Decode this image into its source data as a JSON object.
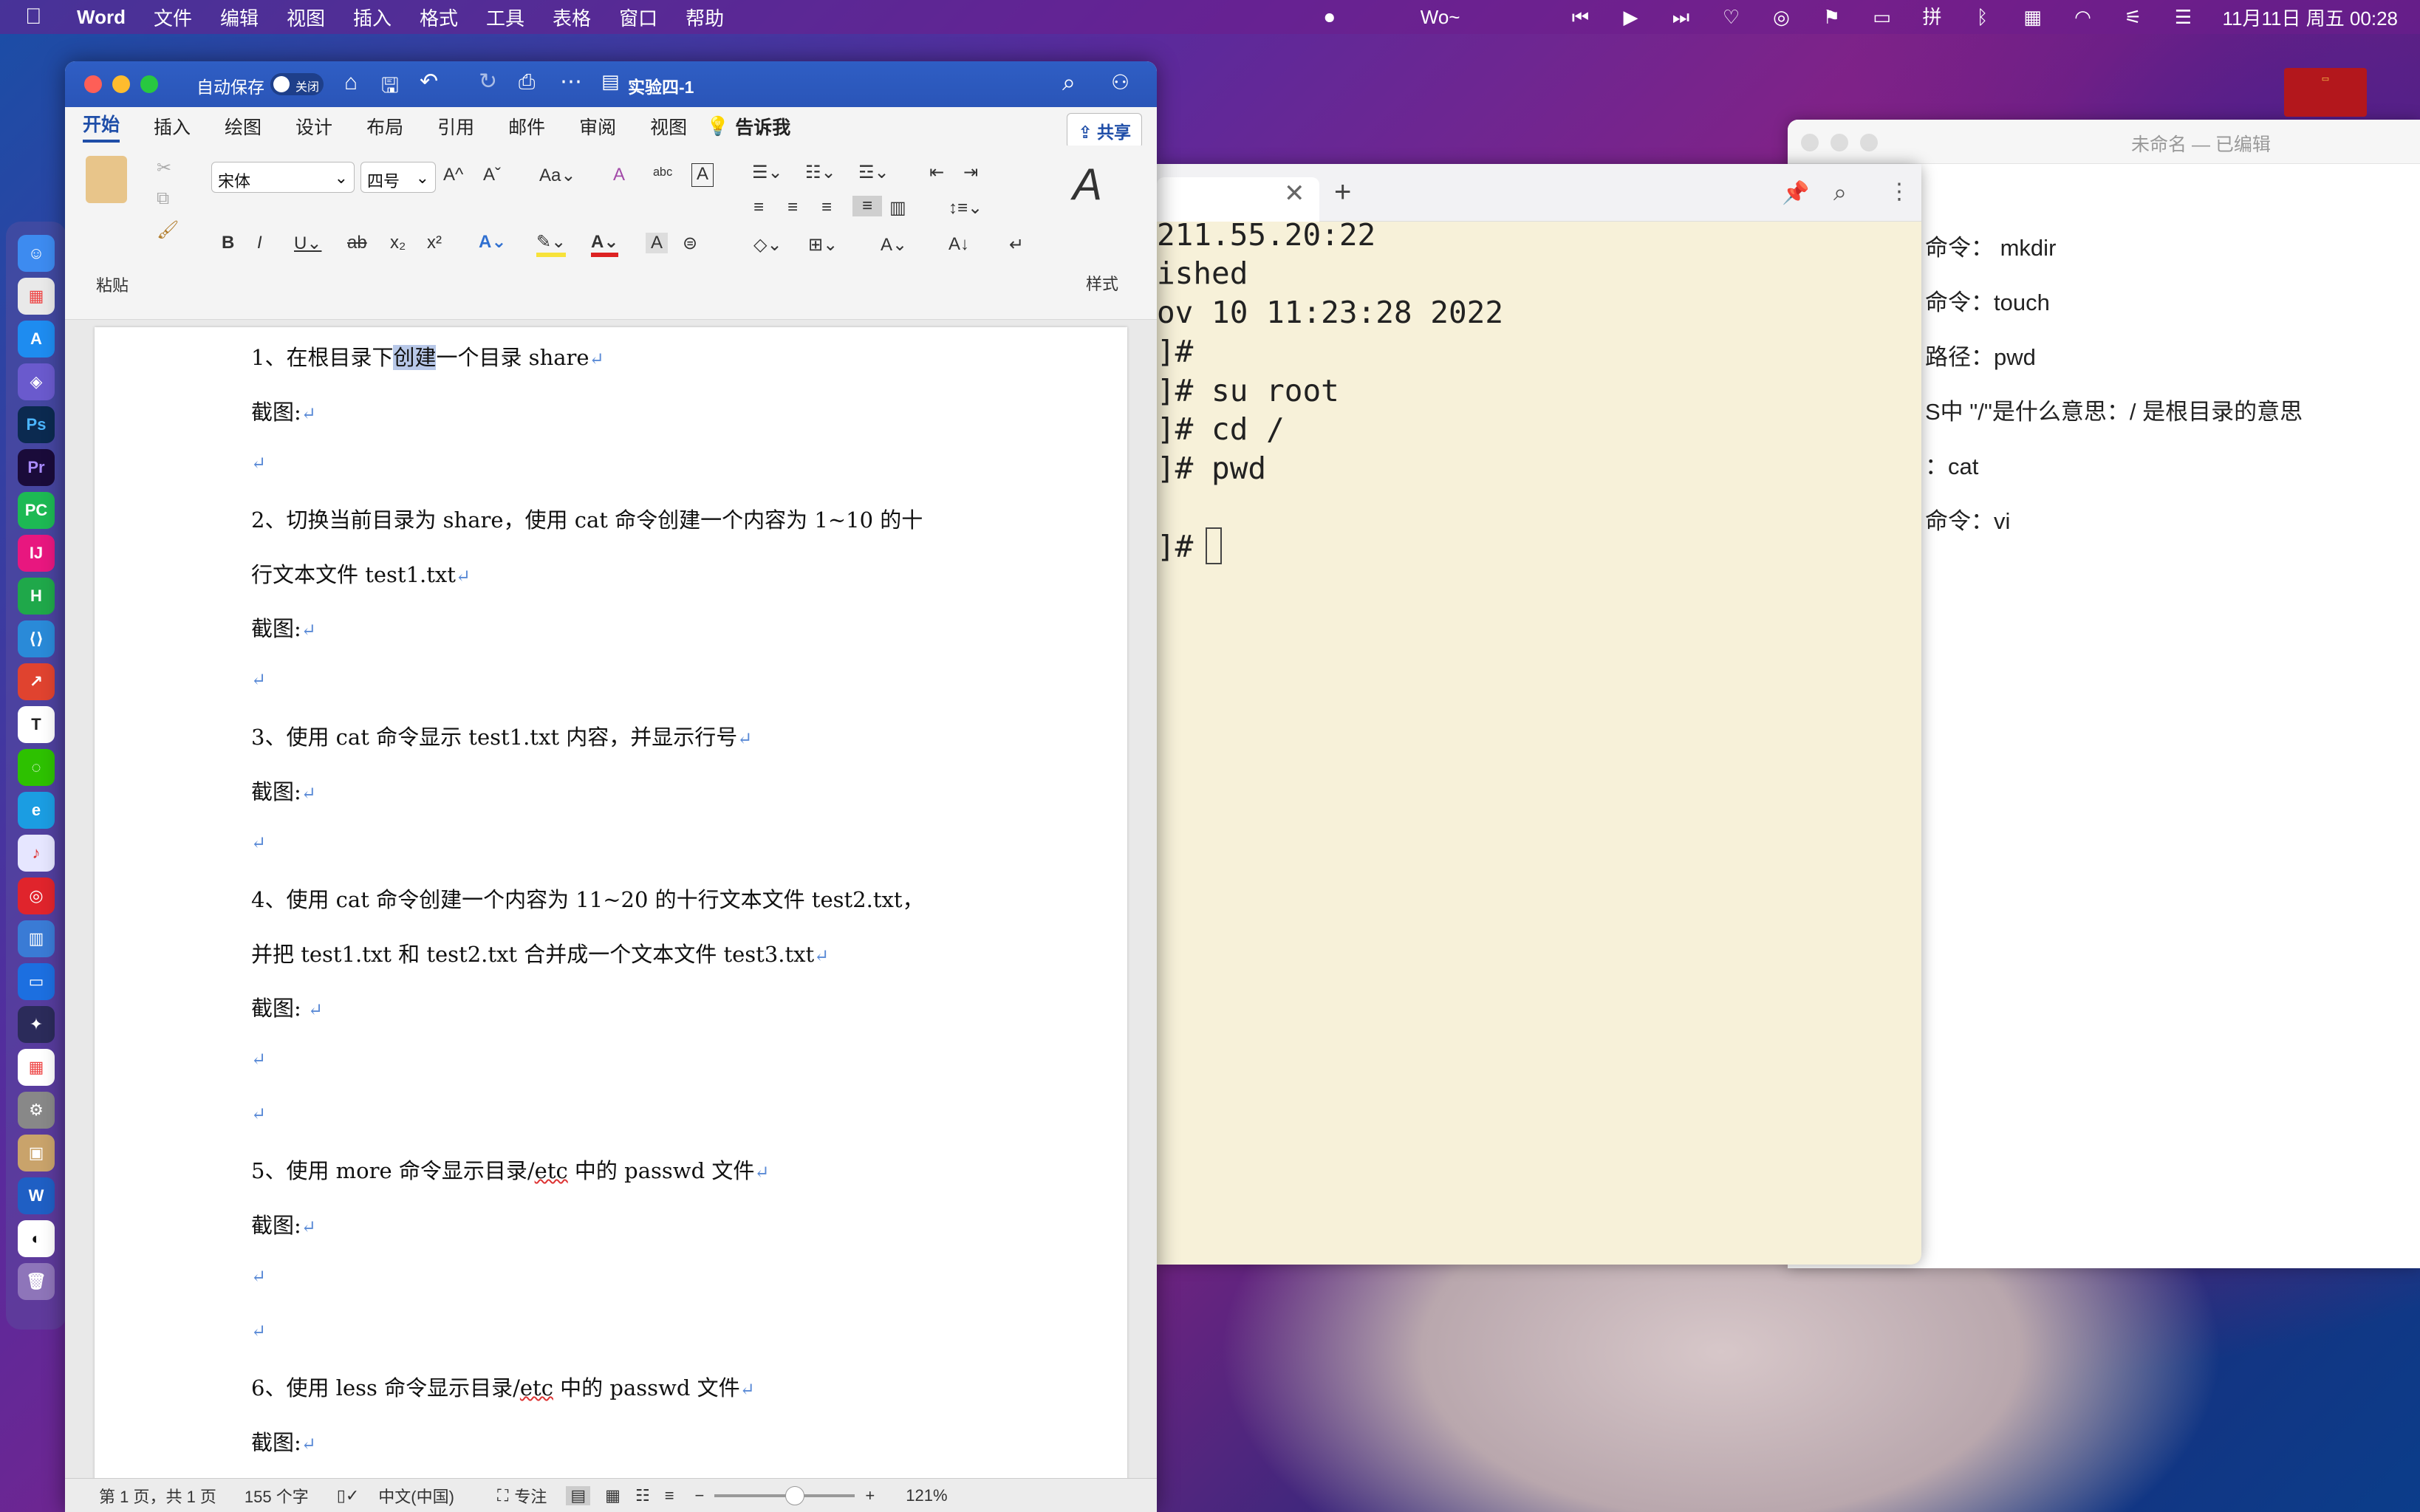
{
  "menubar": {
    "app": "Word",
    "items": [
      "文件",
      "编辑",
      "视图",
      "插入",
      "格式",
      "工具",
      "表格",
      "窗口",
      "帮助"
    ],
    "center_label": "Wo~",
    "datetime": "11月11日 周五 00:28"
  },
  "word": {
    "autosave_label": "自动保存",
    "autosave_state": "关闭",
    "doc_title": "实验四-1",
    "tabs": [
      "开始",
      "插入",
      "绘图",
      "设计",
      "布局",
      "引用",
      "邮件",
      "审阅",
      "视图"
    ],
    "tell_me": "告诉我",
    "share": "共享",
    "paste_label": "粘贴",
    "styles_label": "样式",
    "font_name": "宋体",
    "font_size": "四号",
    "doc": {
      "p1_a": "1、在根目录下",
      "p1_sel": "创建",
      "p1_b": "一个目录 share",
      "shot": "截图:",
      "shot2": "截图: ",
      "p2_line1": "2、切换当前目录为 share，使用 cat 命令创建一个内容为 1~10 的十",
      "p2_line2": "行文本文件 test1.txt",
      "p3": "3、使用 cat 命令显示 test1.txt 内容，并显示行号",
      "p4_line1": "4、使用 cat 命令创建一个内容为 11~20 的十行文本文件 test2.txt，",
      "p4_line2": "并把 test1.txt 和 test2.txt 合并成一个文本文件 test3.txt",
      "p5_a": "5、使用 more 命令显示目录/",
      "p5_etc": "etc",
      "p5_b": " 中的 passwd 文件",
      "p6_a": "6、使用 less 命令显示目录/",
      "p6_etc": "etc",
      "p6_b": " 中的 passwd 文件",
      "pilcrow": "↵"
    },
    "status": {
      "page": "第 1 页，共 1 页",
      "words": "155 个字",
      "lang": "中文(中国)",
      "focus": "专注",
      "zoom": "121%"
    }
  },
  "terminal": {
    "lines": [
      "211.55.20:22",
      "ished",
      "ov 10 11:23:28 2022",
      "]#",
      "]# su root",
      "]# cd /",
      "]# pwd",
      "",
      "]# "
    ]
  },
  "notes": {
    "title": "未命名 — 已编辑",
    "lines": [
      "命令：  mkdir",
      "命令：touch",
      "路径：pwd",
      "S中 \"/\"是什么意思：/ 是根目录的意思",
      "：cat",
      "命令：vi"
    ]
  },
  "colors": {
    "word_blue": "#2f5ec4",
    "terminal_bg": "#f7f1d9",
    "selection": "#b8c8e8"
  }
}
